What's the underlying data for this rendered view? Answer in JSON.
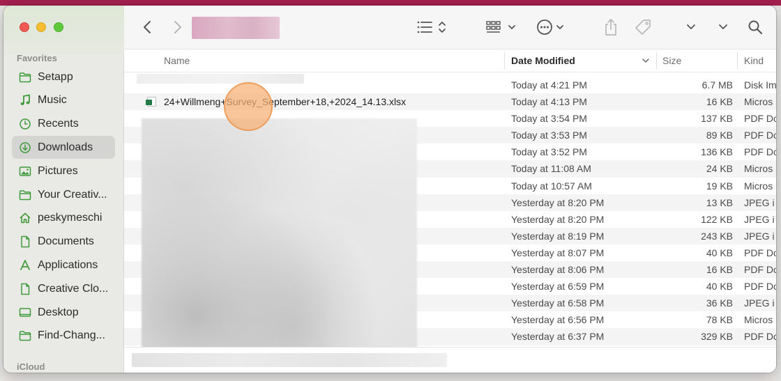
{
  "colors": {
    "accent_green": "#1f7a45",
    "sidebar_icon": "#3f9a3a",
    "highlight": "#f6b074"
  },
  "sidebar": {
    "section_favorites": "Favorites",
    "section_icloud": "iCloud",
    "items": [
      {
        "label": "Setapp",
        "icon": "folder-icon"
      },
      {
        "label": "Music",
        "icon": "music-note-icon"
      },
      {
        "label": "Recents",
        "icon": "clock-icon"
      },
      {
        "label": "Downloads",
        "icon": "download-icon",
        "active": true
      },
      {
        "label": "Pictures",
        "icon": "photo-icon"
      },
      {
        "label": "Your Creativ...",
        "icon": "folder-icon"
      },
      {
        "label": "peskymeschi",
        "icon": "home-icon"
      },
      {
        "label": "Documents",
        "icon": "document-icon"
      },
      {
        "label": "Applications",
        "icon": "applications-icon"
      },
      {
        "label": "Creative Clo...",
        "icon": "document-icon"
      },
      {
        "label": "Desktop",
        "icon": "desktop-icon"
      },
      {
        "label": "Find-Chang...",
        "icon": "folder-icon"
      }
    ]
  },
  "columns": {
    "name": "Name",
    "date_modified": "Date Modified",
    "size": "Size",
    "kind": "Kind"
  },
  "rows": [
    {
      "name": "",
      "date": "Today at 4:21 PM",
      "size": "6.7 MB",
      "kind": "Disk Im"
    },
    {
      "name": "24+Willmeng+Survey_September+18,+2024_14.13.xlsx",
      "date": "Today at 4:13 PM",
      "size": "16 KB",
      "kind": "Micros"
    },
    {
      "name": "",
      "date": "Today at 3:54 PM",
      "size": "137 KB",
      "kind": "PDF Do"
    },
    {
      "name": "",
      "date": "Today at 3:53 PM",
      "size": "89 KB",
      "kind": "PDF Do"
    },
    {
      "name": "",
      "date": "Today at 3:52 PM",
      "size": "136 KB",
      "kind": "PDF Do"
    },
    {
      "name": "",
      "date": "Today at 11:08 AM",
      "size": "24 KB",
      "kind": "Micros"
    },
    {
      "name": "",
      "date": "Today at 10:57 AM",
      "size": "19 KB",
      "kind": "Micros"
    },
    {
      "name": "",
      "date": "Yesterday at 8:20 PM",
      "size": "13 KB",
      "kind": "JPEG i"
    },
    {
      "name": "",
      "date": "Yesterday at 8:20 PM",
      "size": "122 KB",
      "kind": "JPEG i"
    },
    {
      "name": "",
      "date": "Yesterday at 8:19 PM",
      "size": "243 KB",
      "kind": "JPEG i"
    },
    {
      "name": "",
      "date": "Yesterday at 8:07 PM",
      "size": "40 KB",
      "kind": "PDF Do"
    },
    {
      "name": "",
      "date": "Yesterday at 8:06 PM",
      "size": "16 KB",
      "kind": "PDF Do"
    },
    {
      "name": "",
      "date": "Yesterday at 6:59 PM",
      "size": "40 KB",
      "kind": "PDF Do"
    },
    {
      "name": "",
      "date": "Yesterday at 6:58 PM",
      "size": "36 KB",
      "kind": "JPEG i"
    },
    {
      "name": "",
      "date": "Yesterday at 6:56 PM",
      "size": "78 KB",
      "kind": "Micros"
    },
    {
      "name": "",
      "date": "Yesterday at 6:37 PM",
      "size": "329 KB",
      "kind": "PDF Do"
    }
  ]
}
